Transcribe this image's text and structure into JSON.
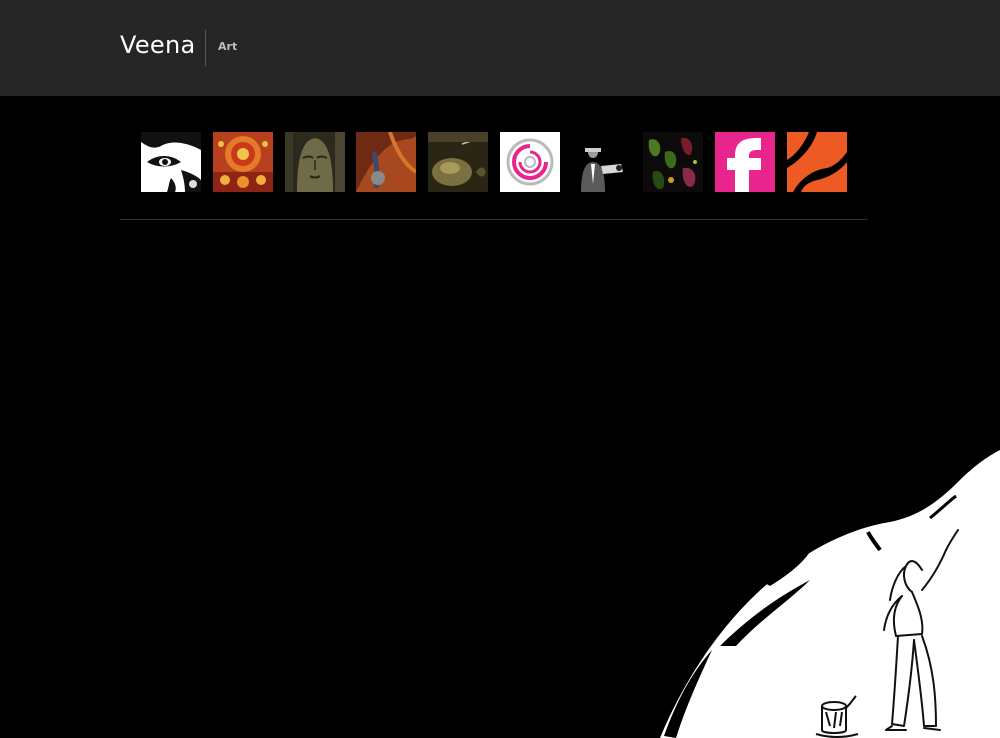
{
  "header": {
    "site_title": "Veena",
    "tagline": "Art",
    "background_color": "#262626"
  },
  "gallery": {
    "thumbnails": [
      {
        "name": "thumb-bharatanatyam-face",
        "icon": "dancer-eye-graphic"
      },
      {
        "name": "thumb-kathakali-mask",
        "icon": "kathakali-painting"
      },
      {
        "name": "thumb-buddha-statue",
        "icon": "bronze-buddha-face"
      },
      {
        "name": "thumb-orange-painting",
        "icon": "orange-abstract-painting"
      },
      {
        "name": "thumb-brass-vessel",
        "icon": "brass-still-life"
      },
      {
        "name": "thumb-pink-circle-logo",
        "icon": "pink-swirl-logo"
      },
      {
        "name": "thumb-gunman",
        "icon": "noir-gunman-poster"
      },
      {
        "name": "thumb-dark-figures",
        "icon": "dark-colorful-figures"
      },
      {
        "name": "thumb-pink-f-logo",
        "icon": "letter-f-logo"
      },
      {
        "name": "thumb-orange-stripe-logo",
        "icon": "orange-stripe-logo"
      }
    ]
  },
  "colors": {
    "page_background": "#000000",
    "accent_pink": "#e8258c",
    "accent_orange": "#ee5a24"
  }
}
